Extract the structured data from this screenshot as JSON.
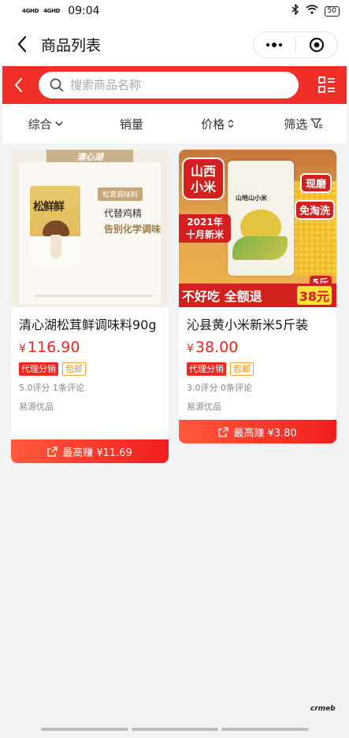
{
  "status_bar": {
    "signal_1": "4GHD",
    "signal_2": "4GHD",
    "time": "09:04",
    "battery": "50"
  },
  "nav": {
    "title": "商品列表"
  },
  "search": {
    "placeholder": "搜索商品名称"
  },
  "sort": {
    "items": [
      "综合",
      "销量",
      "价格",
      "筛选"
    ]
  },
  "products": [
    {
      "title": "清心湖松茸鲜调味料90g",
      "currency": "¥",
      "price": "116.90",
      "tags": [
        "代理分销",
        "包邮"
      ],
      "rating": "5.0评分 1条评论",
      "seller": "易源优品",
      "earn": "最高赚 ¥11.69",
      "image": {
        "brand": "清心湖",
        "pouch_title": "松鲜鲜",
        "pill": "松茸调味料",
        "line1": "代替鸡精",
        "line2": "告别化学调味"
      }
    },
    {
      "title": "沁县黄小米新米5斤装",
      "currency": "¥",
      "price": "38.00",
      "tags": [
        "代理分销",
        "包邮"
      ],
      "rating": "3.0评分 0条评论",
      "seller": "易源优品",
      "earn": "最高赚 ¥3.80",
      "image": {
        "badge_region": "山西\n小米",
        "badge_fresh": "现磨",
        "badge_wash": "免淘洗",
        "badge_year": "2021年\n十月新米",
        "bag_label": "山地山小米",
        "weight": "5斤",
        "slogan": "不好吃 全额退",
        "sale_price": "38元"
      }
    }
  ],
  "brand_mark": "crmeb",
  "colors": {
    "accent_red": "#f22e28",
    "price_red": "#f0261f",
    "tag_orange": "#e8901c"
  }
}
